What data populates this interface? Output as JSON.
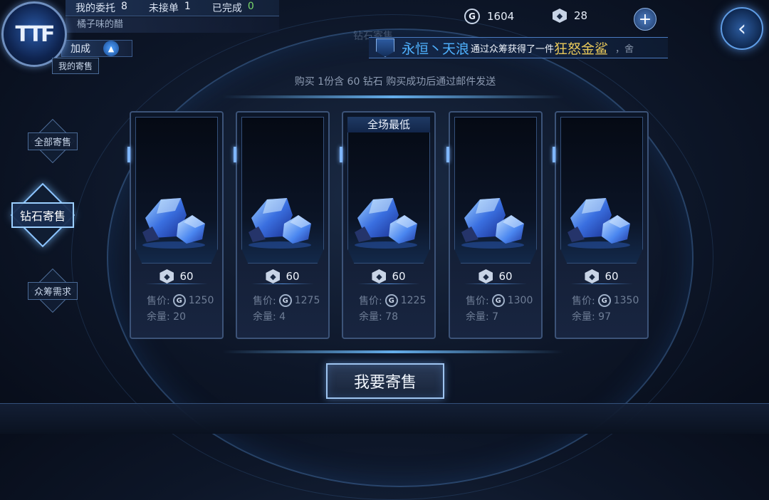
{
  "player": {
    "logo": "TTF",
    "name": "橘子味的醋",
    "stats": [
      {
        "label": "我的委托",
        "value": "8"
      },
      {
        "label": "未接单",
        "value": "1"
      },
      {
        "label": "已完成",
        "value": "0"
      }
    ],
    "bonus_label": "加成",
    "bonus_icon": "chevron-up-icon"
  },
  "nav": {
    "items": [
      {
        "label": "我的寄售"
      },
      {
        "label": "全部寄售"
      },
      {
        "label": "钻石寄售",
        "active": true
      },
      {
        "label": "众筹需求"
      }
    ]
  },
  "currency": {
    "gold_icon": "G",
    "gold": "1604",
    "diamond_icon": "cube-icon",
    "diamond": "28",
    "add_label": "+",
    "back_label": "‹"
  },
  "header": {
    "ghost_title": "钻石寄售"
  },
  "broadcast": {
    "name": "永恒丶天浪",
    "message": "通过众筹获得了一件",
    "item": "狂怒金鲨",
    "tail": "，舍"
  },
  "description": "购买 1份含  60 钻石 购买成功后通过邮件发送",
  "listings": [
    {
      "amount": "60",
      "price": "1250",
      "stock": "20",
      "tag": ""
    },
    {
      "amount": "60",
      "price": "1275",
      "stock": "4",
      "tag": ""
    },
    {
      "amount": "60",
      "price": "1225",
      "stock": "78",
      "tag": "全场最低"
    },
    {
      "amount": "60",
      "price": "1300",
      "stock": "7",
      "tag": ""
    },
    {
      "amount": "60",
      "price": "1350",
      "stock": "97",
      "tag": ""
    }
  ],
  "labels": {
    "price": "售价:",
    "stock": "余量:"
  },
  "sell_button": "我要寄售",
  "colors": {
    "accent": "#4fb2ff",
    "gold_text": "#e8c85a",
    "green": "#7ad86a",
    "background": "#0d1628"
  }
}
